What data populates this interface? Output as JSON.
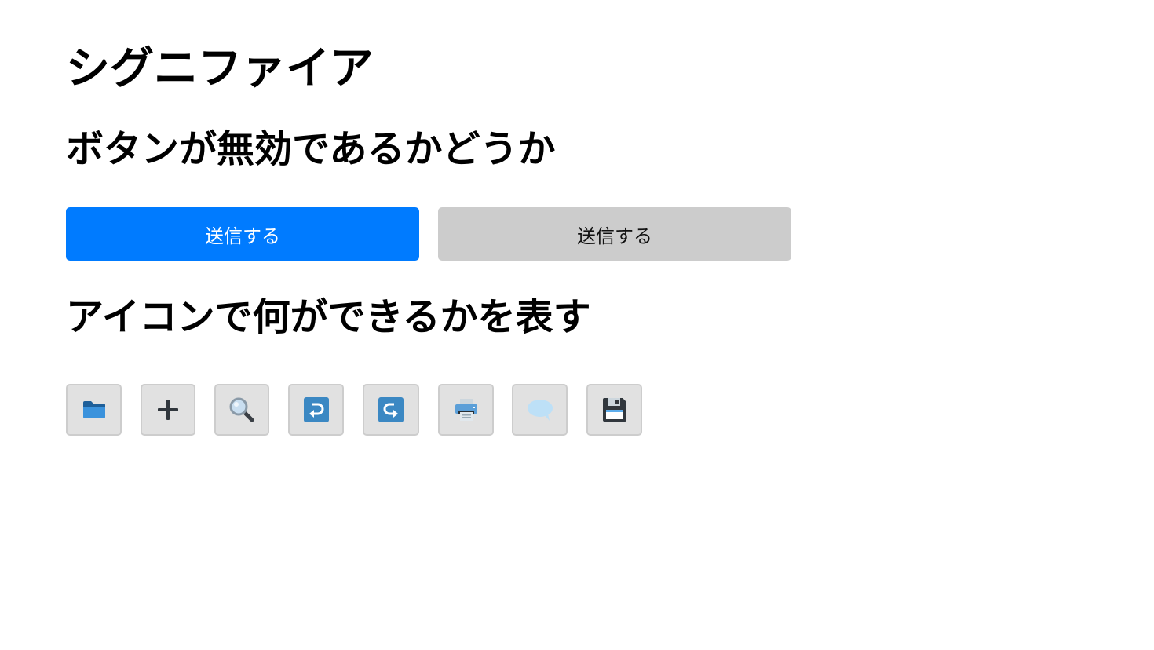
{
  "title": "シグニファイア",
  "sections": {
    "disabled": {
      "heading": "ボタンが無効であるかどうか",
      "buttons": [
        {
          "label": "送信する",
          "state": "enabled",
          "color": "#007bff"
        },
        {
          "label": "送信する",
          "state": "disabled",
          "color": "#cccccc"
        }
      ]
    },
    "icons": {
      "heading": "アイコンで何ができるかを表す",
      "buttons": [
        {
          "icon": "folder-icon"
        },
        {
          "icon": "plus-icon"
        },
        {
          "icon": "search-icon"
        },
        {
          "icon": "undo-icon"
        },
        {
          "icon": "redo-icon"
        },
        {
          "icon": "printer-icon"
        },
        {
          "icon": "speech-bubble-icon"
        },
        {
          "icon": "floppy-disk-icon"
        }
      ]
    }
  }
}
